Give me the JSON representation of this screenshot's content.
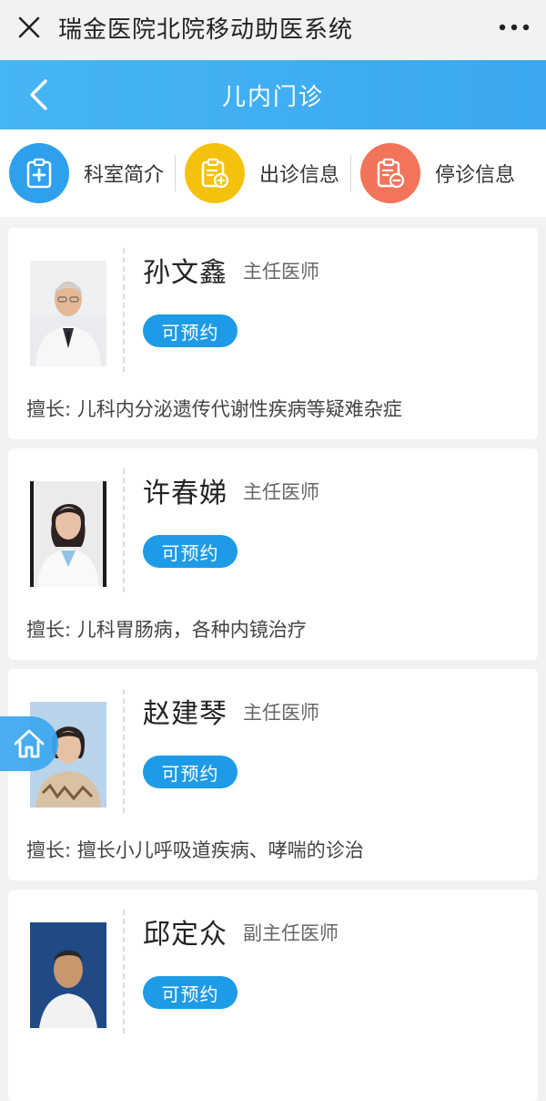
{
  "app": {
    "title": "瑞金医院北院移动助医系统"
  },
  "header": {
    "title": "儿内门诊",
    "color": "#3aa7f0"
  },
  "menu": [
    {
      "label": "科室简介",
      "icon": "clipboard-plus-icon",
      "color": "#2fa0ee"
    },
    {
      "label": "出诊信息",
      "icon": "clipboard-add-icon",
      "color": "#f4c20d"
    },
    {
      "label": "停诊信息",
      "icon": "clipboard-minus-icon",
      "color": "#f2745a"
    }
  ],
  "doctors": [
    {
      "name": "孙文鑫",
      "title": "主任医师",
      "status": "可预约",
      "specialty_label": "擅长:",
      "specialty": "儿科内分泌遗传代谢性疾病等疑难杂症"
    },
    {
      "name": "许春娣",
      "title": "主任医师",
      "status": "可预约",
      "specialty_label": "擅长:",
      "specialty": "儿科胃肠病，各种内镜治疗"
    },
    {
      "name": "赵建琴",
      "title": "主任医师",
      "status": "可预约",
      "specialty_label": "擅长:",
      "specialty": "擅长小儿呼吸道疾病、哮喘的诊治"
    },
    {
      "name": "邱定众",
      "title": "副主任医师",
      "status": "可预约",
      "specialty_label": "",
      "specialty": ""
    }
  ],
  "badge_color": "#1e9be6",
  "floating": {
    "icon": "home-icon"
  }
}
